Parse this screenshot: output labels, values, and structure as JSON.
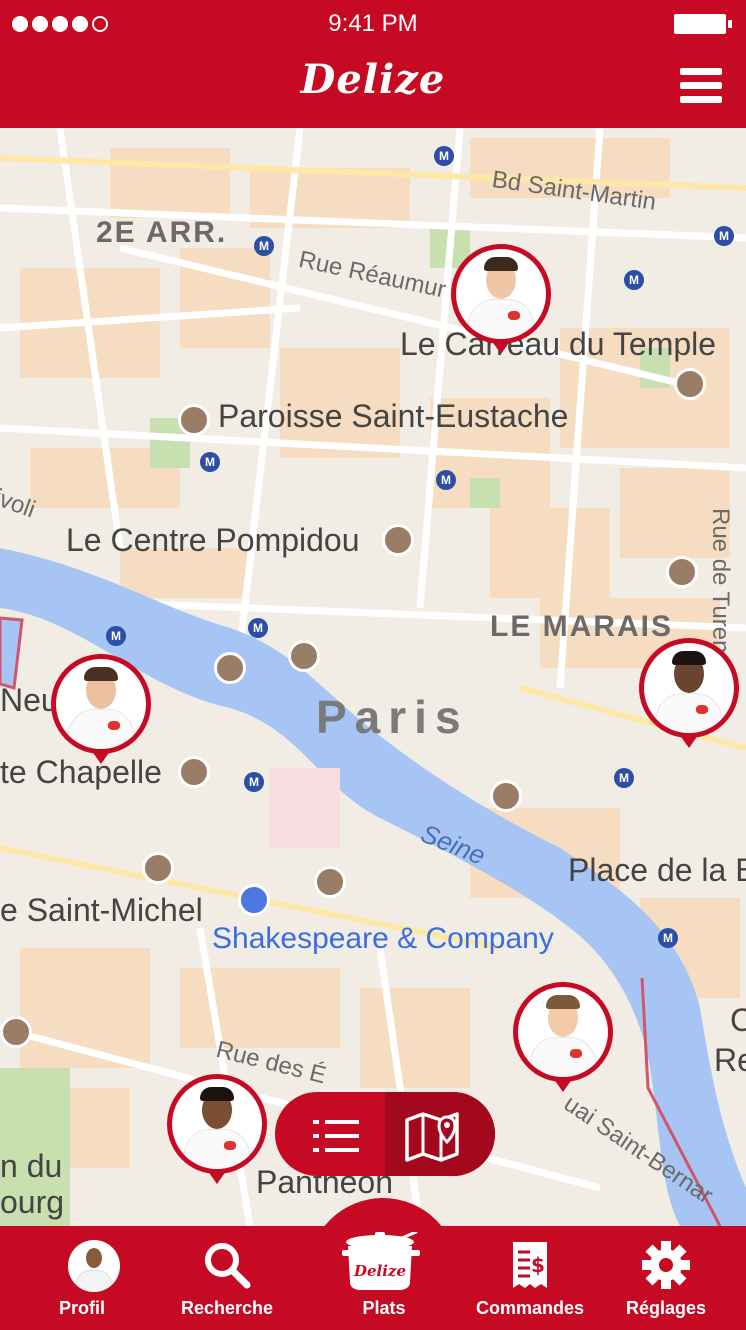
{
  "status": {
    "time": "9:41 PM",
    "signal_bars": 4,
    "signal_total": 5
  },
  "header": {
    "brand": "Delize",
    "menu_icon": "hamburger-menu-icon"
  },
  "map": {
    "labels": {
      "arr": "2E ARR.",
      "bd_saint_martin": "Bd Saint-Martin",
      "rue_reaumur": "Rue Réaumur",
      "carreau": "Le Carreau du Temple",
      "saint_eustache": "Paroisse Saint-Eustache",
      "rivoli": "ivoli",
      "pompidou": "Le Centre Pompidou",
      "marais": "LE MARAIS",
      "paris": "Paris",
      "neuf": "Neuf",
      "chapelle": "te Chapelle",
      "seine": "Seine",
      "place": "Place de la B",
      "saint_michel": "e Saint-Michel",
      "shakespeare": "Shakespeare & Company",
      "rue_des_ecoles": "Rue des É",
      "quai": "uai Saint-Bernar",
      "pantheon": "Panthéon",
      "jardin1": "n du",
      "jardin2": "ourg",
      "turenne": "Rue de Turenne",
      "c": "C",
      "re": "Re"
    }
  },
  "toggle": {
    "list_icon": "list-icon",
    "map_icon": "map-icon",
    "active": "map"
  },
  "nav": {
    "profil": "Profil",
    "recherche": "Recherche",
    "plats": "Plats",
    "commandes": "Commandes",
    "reglages": "Réglages",
    "pot_text": "Delize"
  },
  "colors": {
    "brand_red": "#c70a23",
    "water": "#a6c4f4",
    "land": "#f1ece4"
  }
}
